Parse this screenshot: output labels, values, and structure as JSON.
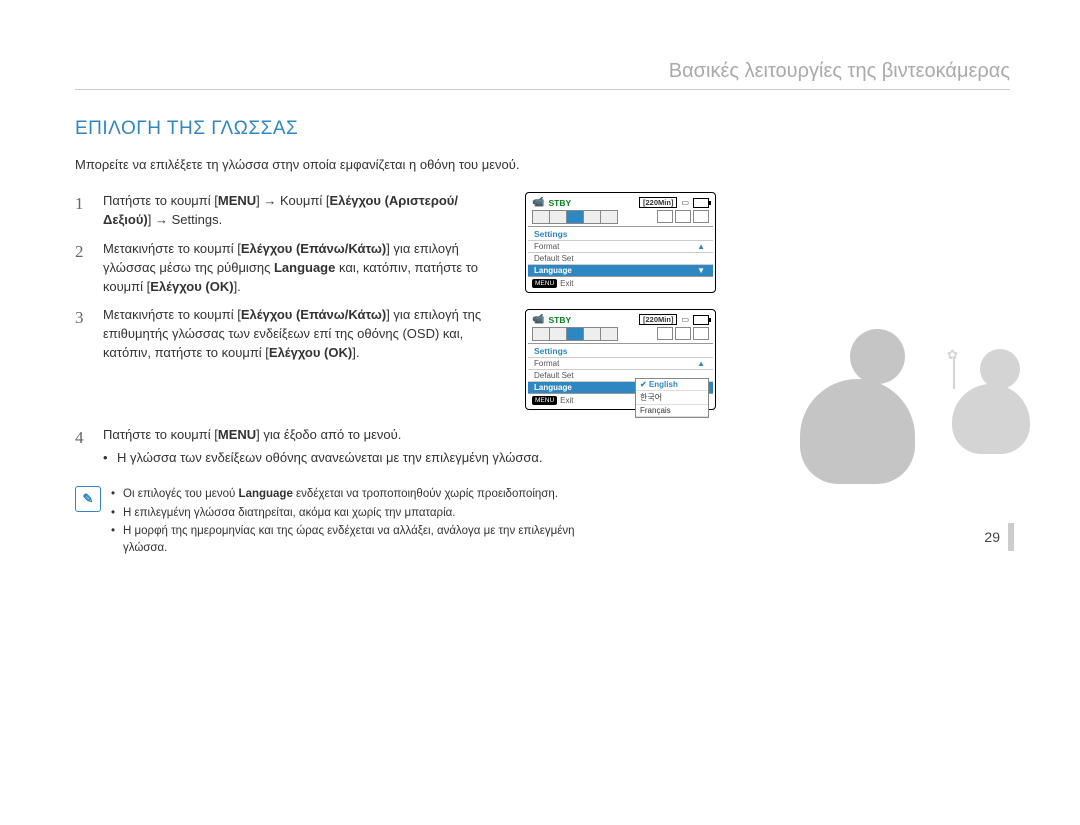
{
  "chapter": "Βασικές λειτουργίες της βιντεοκάμερας",
  "section_title": "ΕΠΙΛΟΓΗ ΤΗΣ ΓΛΩΣΣΑΣ",
  "intro": "Μπορείτε να επιλέξετε τη γλώσσα στην οποία εμφανίζεται η οθόνη του μενού.",
  "steps": {
    "s1": {
      "num": "1",
      "p1": "Πατήστε το κουμπί [",
      "b1": "MENU",
      "p2": "]  ",
      "arrow1": "→",
      "p3": "  Κουμπί [",
      "b2": "Ελέγχου (Αριστερού/Δεξιού)",
      "p4": "]  ",
      "arrow2": "→",
      "p5": "  Settings."
    },
    "s2": {
      "num": "2",
      "p1": "Μετακινήστε το κουμπί [",
      "b1": "Ελέγχου (Επάνω/Κάτω)",
      "p2": "] για επιλογή γλώσσας μέσω της ρύθμισης ",
      "b2": "Language",
      "p3": " και, κατόπιν, πατήστε το κουμπί [",
      "b3": "Ελέγχου (OK)",
      "p4": "]."
    },
    "s3": {
      "num": "3",
      "p1": "Μετακινήστε το κουμπί [",
      "b1": "Ελέγχου (Επάνω/Κάτω)",
      "p2": "] για επιλογή της επιθυμητής γλώσσας των ενδείξεων επί της οθόνης (OSD) και, κατόπιν, πατήστε το κουμπί [",
      "b2": "Ελέγχου (OK)",
      "p3": "]."
    },
    "s4": {
      "num": "4",
      "p1": "Πατήστε το κουμπί [",
      "b1": "MENU",
      "p2": "] για έξοδο από το μενού.",
      "bullet": "Η γλώσσα των ενδείξεων οθόνης ανανεώνεται με την επιλεγμένη γλώσσα."
    }
  },
  "notes": {
    "n1_a": "Οι επιλογές του μενού ",
    "n1_b": "Language",
    "n1_c": " ενδέχεται να τροποποιηθούν χωρίς προειδοποίηση.",
    "n2": "Η επιλεγμένη γλώσσα διατηρείται, ακόμα και χωρίς την μπαταρία.",
    "n3": "Η μορφή της ημερομηνίας και της ώρας ενδέχεται να αλλάξει, ανάλογα με την επιλεγμένη γλώσσα."
  },
  "lcd1": {
    "stby": "STBY",
    "time": "[220Min]",
    "label": "Settings",
    "rows": [
      "Format",
      "Default Set",
      "Language"
    ],
    "exit_btn": "MENU",
    "exit": "Exit"
  },
  "lcd2": {
    "stby": "STBY",
    "time": "[220Min]",
    "label": "Settings",
    "rows": [
      "Format",
      "Default Set",
      "Language"
    ],
    "langs": [
      "English",
      "한국어",
      "Français"
    ],
    "exit_btn": "MENU",
    "exit": "Exit"
  },
  "page_number": "29"
}
